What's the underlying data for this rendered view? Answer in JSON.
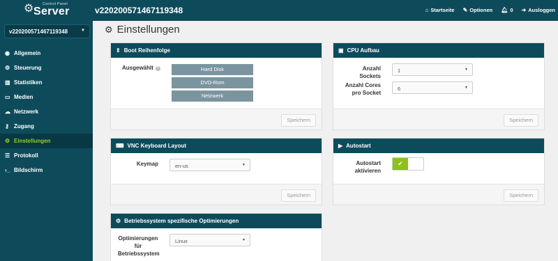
{
  "brand": {
    "small": "Control Panel",
    "name": "Server",
    "icon": "gears-icon"
  },
  "server_id": "v220200571467119348",
  "topnav": [
    {
      "label": "Startseite",
      "icon": "home-icon"
    },
    {
      "label": "Optionen",
      "icon": "wrench-icon"
    },
    {
      "label": "0",
      "icon": "bell-icon"
    },
    {
      "label": "Ausloggen",
      "icon": "logout-icon"
    }
  ],
  "sidebar": {
    "selected_server": "v220200571467119348",
    "items": [
      {
        "label": "Allgemein",
        "icon": "eye-icon"
      },
      {
        "label": "Steuerung",
        "icon": "gear-icon"
      },
      {
        "label": "Statistiken",
        "icon": "bar-chart-icon"
      },
      {
        "label": "Medien",
        "icon": "drive-icon"
      },
      {
        "label": "Netzwerk",
        "icon": "cloud-icon"
      },
      {
        "label": "Zugang",
        "icon": "key-icon"
      },
      {
        "label": "Einstellungen",
        "icon": "gears-icon",
        "active": true
      },
      {
        "label": "Protokoll",
        "icon": "list-icon"
      },
      {
        "label": "Bildschirm",
        "icon": "terminal-icon"
      }
    ]
  },
  "page_title": "Einstellungen",
  "save_label": "Speichern",
  "boot": {
    "title": "Boot Reihenfolge",
    "label": "Ausgewählt",
    "options": [
      "Hard Disk",
      "DVD-Rom",
      "Netzwerk"
    ]
  },
  "cpu": {
    "title": "CPU Aufbau",
    "sockets_label": "Anzahl Sockets",
    "sockets_value": "1",
    "cores_label_1": "Anzahl Cores",
    "cores_label_2": "pro Socket",
    "cores_value": "6"
  },
  "vnc": {
    "title": "VNC Keyboard Layout",
    "keymap_label": "Keymap",
    "keymap_value": "en-us"
  },
  "autostart": {
    "title": "Autostart",
    "label_1": "Autostart",
    "label_2": "aktivieren",
    "enabled": true
  },
  "os": {
    "title": "Betriebssystem spezifische Optimierungen",
    "label_1": "Optimierungen",
    "label_2": "für",
    "label_3": "Betriebssystem",
    "value": "Linux"
  },
  "colors": {
    "header": "#0d4b5b",
    "active_nav": "#95d11f",
    "toggle_on": "#8cc21b",
    "boot_option": "#7b95a0"
  }
}
